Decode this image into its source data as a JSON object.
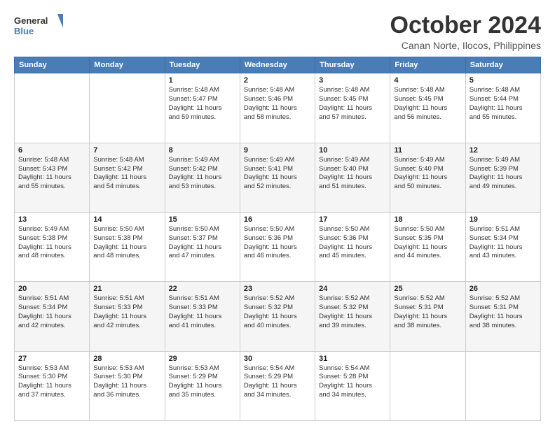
{
  "logo": {
    "line1": "General",
    "line2": "Blue"
  },
  "title": "October 2024",
  "subtitle": "Canan Norte, Ilocos, Philippines",
  "days_of_week": [
    "Sunday",
    "Monday",
    "Tuesday",
    "Wednesday",
    "Thursday",
    "Friday",
    "Saturday"
  ],
  "weeks": [
    [
      {
        "day": "",
        "text": ""
      },
      {
        "day": "",
        "text": ""
      },
      {
        "day": "1",
        "text": "Sunrise: 5:48 AM\nSunset: 5:47 PM\nDaylight: 11 hours\nand 59 minutes."
      },
      {
        "day": "2",
        "text": "Sunrise: 5:48 AM\nSunset: 5:46 PM\nDaylight: 11 hours\nand 58 minutes."
      },
      {
        "day": "3",
        "text": "Sunrise: 5:48 AM\nSunset: 5:45 PM\nDaylight: 11 hours\nand 57 minutes."
      },
      {
        "day": "4",
        "text": "Sunrise: 5:48 AM\nSunset: 5:45 PM\nDaylight: 11 hours\nand 56 minutes."
      },
      {
        "day": "5",
        "text": "Sunrise: 5:48 AM\nSunset: 5:44 PM\nDaylight: 11 hours\nand 55 minutes."
      }
    ],
    [
      {
        "day": "6",
        "text": "Sunrise: 5:48 AM\nSunset: 5:43 PM\nDaylight: 11 hours\nand 55 minutes."
      },
      {
        "day": "7",
        "text": "Sunrise: 5:48 AM\nSunset: 5:42 PM\nDaylight: 11 hours\nand 54 minutes."
      },
      {
        "day": "8",
        "text": "Sunrise: 5:49 AM\nSunset: 5:42 PM\nDaylight: 11 hours\nand 53 minutes."
      },
      {
        "day": "9",
        "text": "Sunrise: 5:49 AM\nSunset: 5:41 PM\nDaylight: 11 hours\nand 52 minutes."
      },
      {
        "day": "10",
        "text": "Sunrise: 5:49 AM\nSunset: 5:40 PM\nDaylight: 11 hours\nand 51 minutes."
      },
      {
        "day": "11",
        "text": "Sunrise: 5:49 AM\nSunset: 5:40 PM\nDaylight: 11 hours\nand 50 minutes."
      },
      {
        "day": "12",
        "text": "Sunrise: 5:49 AM\nSunset: 5:39 PM\nDaylight: 11 hours\nand 49 minutes."
      }
    ],
    [
      {
        "day": "13",
        "text": "Sunrise: 5:49 AM\nSunset: 5:38 PM\nDaylight: 11 hours\nand 48 minutes."
      },
      {
        "day": "14",
        "text": "Sunrise: 5:50 AM\nSunset: 5:38 PM\nDaylight: 11 hours\nand 48 minutes."
      },
      {
        "day": "15",
        "text": "Sunrise: 5:50 AM\nSunset: 5:37 PM\nDaylight: 11 hours\nand 47 minutes."
      },
      {
        "day": "16",
        "text": "Sunrise: 5:50 AM\nSunset: 5:36 PM\nDaylight: 11 hours\nand 46 minutes."
      },
      {
        "day": "17",
        "text": "Sunrise: 5:50 AM\nSunset: 5:36 PM\nDaylight: 11 hours\nand 45 minutes."
      },
      {
        "day": "18",
        "text": "Sunrise: 5:50 AM\nSunset: 5:35 PM\nDaylight: 11 hours\nand 44 minutes."
      },
      {
        "day": "19",
        "text": "Sunrise: 5:51 AM\nSunset: 5:34 PM\nDaylight: 11 hours\nand 43 minutes."
      }
    ],
    [
      {
        "day": "20",
        "text": "Sunrise: 5:51 AM\nSunset: 5:34 PM\nDaylight: 11 hours\nand 42 minutes."
      },
      {
        "day": "21",
        "text": "Sunrise: 5:51 AM\nSunset: 5:33 PM\nDaylight: 11 hours\nand 42 minutes."
      },
      {
        "day": "22",
        "text": "Sunrise: 5:51 AM\nSunset: 5:33 PM\nDaylight: 11 hours\nand 41 minutes."
      },
      {
        "day": "23",
        "text": "Sunrise: 5:52 AM\nSunset: 5:32 PM\nDaylight: 11 hours\nand 40 minutes."
      },
      {
        "day": "24",
        "text": "Sunrise: 5:52 AM\nSunset: 5:32 PM\nDaylight: 11 hours\nand 39 minutes."
      },
      {
        "day": "25",
        "text": "Sunrise: 5:52 AM\nSunset: 5:31 PM\nDaylight: 11 hours\nand 38 minutes."
      },
      {
        "day": "26",
        "text": "Sunrise: 5:52 AM\nSunset: 5:31 PM\nDaylight: 11 hours\nand 38 minutes."
      }
    ],
    [
      {
        "day": "27",
        "text": "Sunrise: 5:53 AM\nSunset: 5:30 PM\nDaylight: 11 hours\nand 37 minutes."
      },
      {
        "day": "28",
        "text": "Sunrise: 5:53 AM\nSunset: 5:30 PM\nDaylight: 11 hours\nand 36 minutes."
      },
      {
        "day": "29",
        "text": "Sunrise: 5:53 AM\nSunset: 5:29 PM\nDaylight: 11 hours\nand 35 minutes."
      },
      {
        "day": "30",
        "text": "Sunrise: 5:54 AM\nSunset: 5:29 PM\nDaylight: 11 hours\nand 34 minutes."
      },
      {
        "day": "31",
        "text": "Sunrise: 5:54 AM\nSunset: 5:28 PM\nDaylight: 11 hours\nand 34 minutes."
      },
      {
        "day": "",
        "text": ""
      },
      {
        "day": "",
        "text": ""
      }
    ]
  ]
}
